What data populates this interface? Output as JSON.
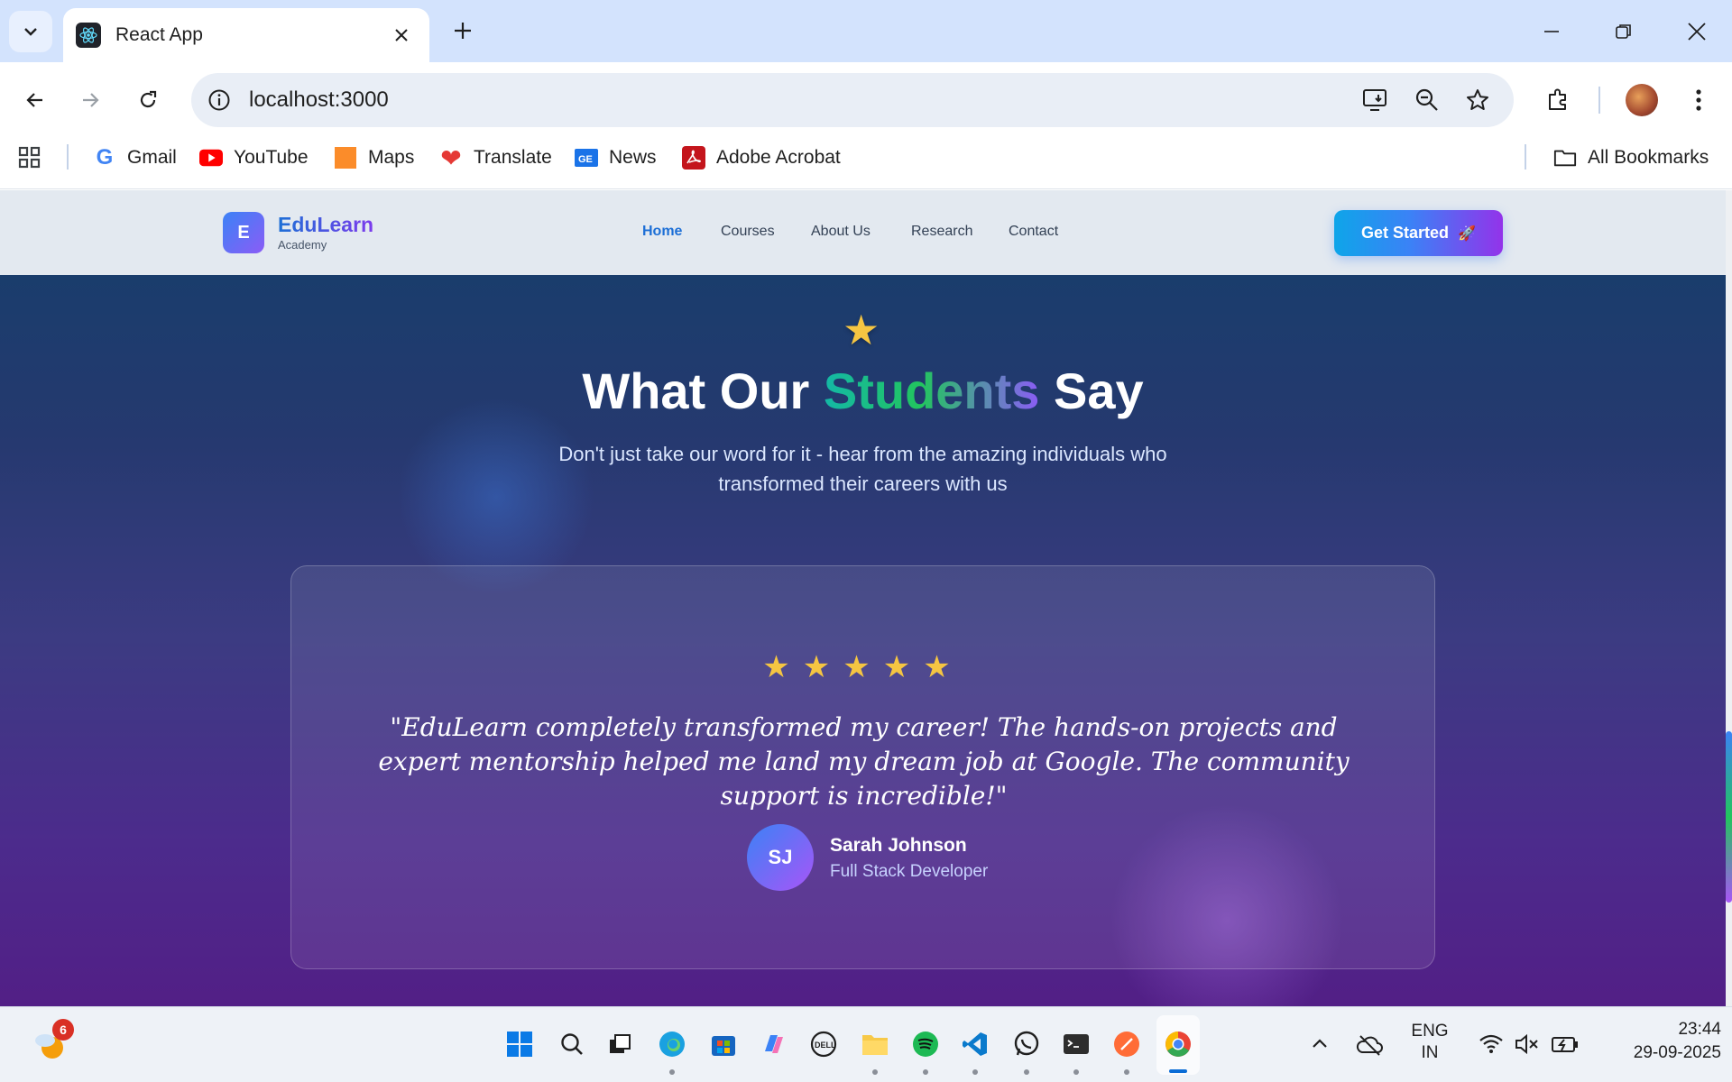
{
  "browser": {
    "tab_title": "React App",
    "url": "localhost:3000",
    "bookmarks": [
      {
        "label": "Gmail",
        "icon": "gmail-icon"
      },
      {
        "label": "YouTube",
        "icon": "youtube-icon"
      },
      {
        "label": "Maps",
        "icon": "maps-icon"
      },
      {
        "label": "Translate",
        "icon": "translate-icon"
      },
      {
        "label": "News",
        "icon": "news-icon"
      },
      {
        "label": "Adobe Acrobat",
        "icon": "acrobat-icon"
      }
    ],
    "all_bookmarks": "All Bookmarks"
  },
  "site": {
    "logo_letter": "E",
    "logo_name": "EduLearn",
    "logo_sub": "Academy",
    "nav": [
      "Home",
      "Courses",
      "About Us",
      "Research",
      "Contact"
    ],
    "active_nav": "Home",
    "cta_label": "Get Started",
    "cta_icon": "🚀"
  },
  "testimonials": {
    "heading_pre": "What Our ",
    "heading_highlight": "Students",
    "heading_post": " Say",
    "subheading": "Don't just take our word for it - hear from the amazing individuals who transformed their careers with us",
    "rating": 5,
    "stars": "★★★★★",
    "quote": "\"EduLearn completely transformed my career! The hands-on projects and expert mentorship helped me land my dream job at Google. The community support is incredible!\"",
    "initials": "SJ",
    "name": "Sarah Johnson",
    "role": "Full Stack Developer"
  },
  "taskbar": {
    "weather_badge": "6",
    "lang_top": "ENG",
    "lang_bottom": "IN",
    "time": "23:44",
    "date": "29-09-2025"
  },
  "colors": {
    "accent": "#1d6fd6",
    "purple": "#7c3aed",
    "star": "#f5c542"
  }
}
